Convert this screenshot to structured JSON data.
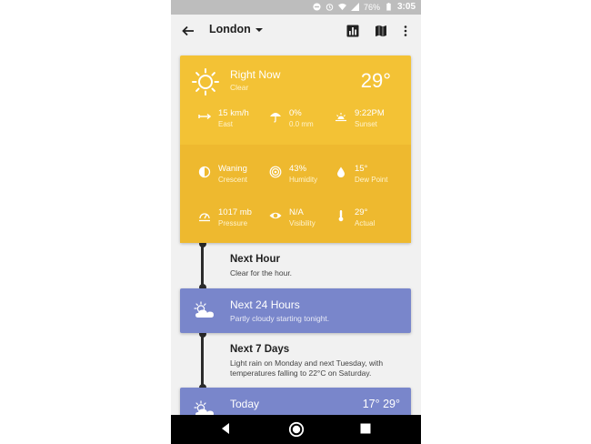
{
  "status_bar": {
    "battery": "76%",
    "time": "3:05"
  },
  "toolbar": {
    "city": "London",
    "icons": [
      "back-arrow-icon",
      "chart-icon",
      "map-icon",
      "more-vert-icon"
    ]
  },
  "right_now": {
    "title": "Right Now",
    "condition": "Clear",
    "temperature": "29°",
    "stats": [
      {
        "icon": "wind-icon",
        "value": "15 km/h",
        "label": "East"
      },
      {
        "icon": "umbrella-icon",
        "value": "0%",
        "label": "0.0 mm"
      },
      {
        "icon": "sunset-icon",
        "value": "9:22PM",
        "label": "Sunset"
      },
      {
        "icon": "moon-phase-icon",
        "value": "Waning",
        "label": "Crescent"
      },
      {
        "icon": "humidity-icon",
        "value": "43%",
        "label": "Humidity"
      },
      {
        "icon": "dew-drop-icon",
        "value": "15°",
        "label": "Dew Point"
      },
      {
        "icon": "pressure-icon",
        "value": "1017 mb",
        "label": "Pressure"
      },
      {
        "icon": "eye-icon",
        "value": "N/A",
        "label": "Visibility"
      },
      {
        "icon": "thermometer-icon",
        "value": "29°",
        "label": "Actual"
      }
    ]
  },
  "next_hour": {
    "title": "Next Hour",
    "summary": "Clear for the hour."
  },
  "next_24_hours": {
    "title": "Next 24 Hours",
    "summary": "Partly cloudy starting tonight."
  },
  "next_7_days": {
    "title": "Next 7 Days",
    "summary_line1": "Light rain on Monday and next Tuesday, with",
    "summary_line2": "temperatures falling to 22°C on Saturday."
  },
  "today": {
    "title": "Today",
    "low": "17°",
    "high": "29°"
  },
  "colors": {
    "current_card": "#f3c235",
    "forecast_card": "#7986cb",
    "background": "#f1f1f1"
  }
}
